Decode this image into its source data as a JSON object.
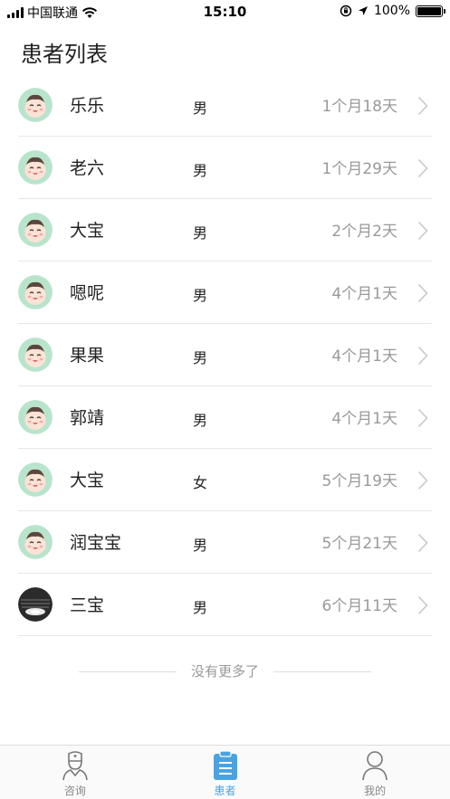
{
  "status": {
    "carrier": "中国联通",
    "time": "15:10",
    "battery": "100%",
    "battery_level": 1.0
  },
  "page_title": "患者列表",
  "patients": [
    {
      "name": "乐乐",
      "gender": "男",
      "age": "1个月18天",
      "avatar": "baby-avatar"
    },
    {
      "name": "老六",
      "gender": "男",
      "age": "1个月29天",
      "avatar": "baby-avatar"
    },
    {
      "name": "大宝",
      "gender": "男",
      "age": "2个月2天",
      "avatar": "baby-avatar"
    },
    {
      "name": "嗯呢",
      "gender": "男",
      "age": "4个月1天",
      "avatar": "baby-avatar"
    },
    {
      "name": "果果",
      "gender": "男",
      "age": "4个月1天",
      "avatar": "baby-avatar"
    },
    {
      "name": "郭靖",
      "gender": "男",
      "age": "4个月1天",
      "avatar": "baby-avatar"
    },
    {
      "name": "大宝",
      "gender": "女",
      "age": "5个月19天",
      "avatar": "baby-avatar"
    },
    {
      "name": "润宝宝",
      "gender": "男",
      "age": "5个月21天",
      "avatar": "baby-avatar"
    },
    {
      "name": "三宝",
      "gender": "男",
      "age": "6个月11天",
      "avatar": "photo-avatar"
    }
  ],
  "no_more_text": "没有更多了",
  "tabs": [
    {
      "label": "咨询",
      "icon": "nurse-icon",
      "active": false
    },
    {
      "label": "患者",
      "icon": "clipboard-icon",
      "active": true
    },
    {
      "label": "我的",
      "icon": "person-icon",
      "active": false
    }
  ],
  "colors": {
    "accent": "#4aa3e0",
    "avatar_bg": "#b9e4cc",
    "secondary_text": "#999999"
  }
}
